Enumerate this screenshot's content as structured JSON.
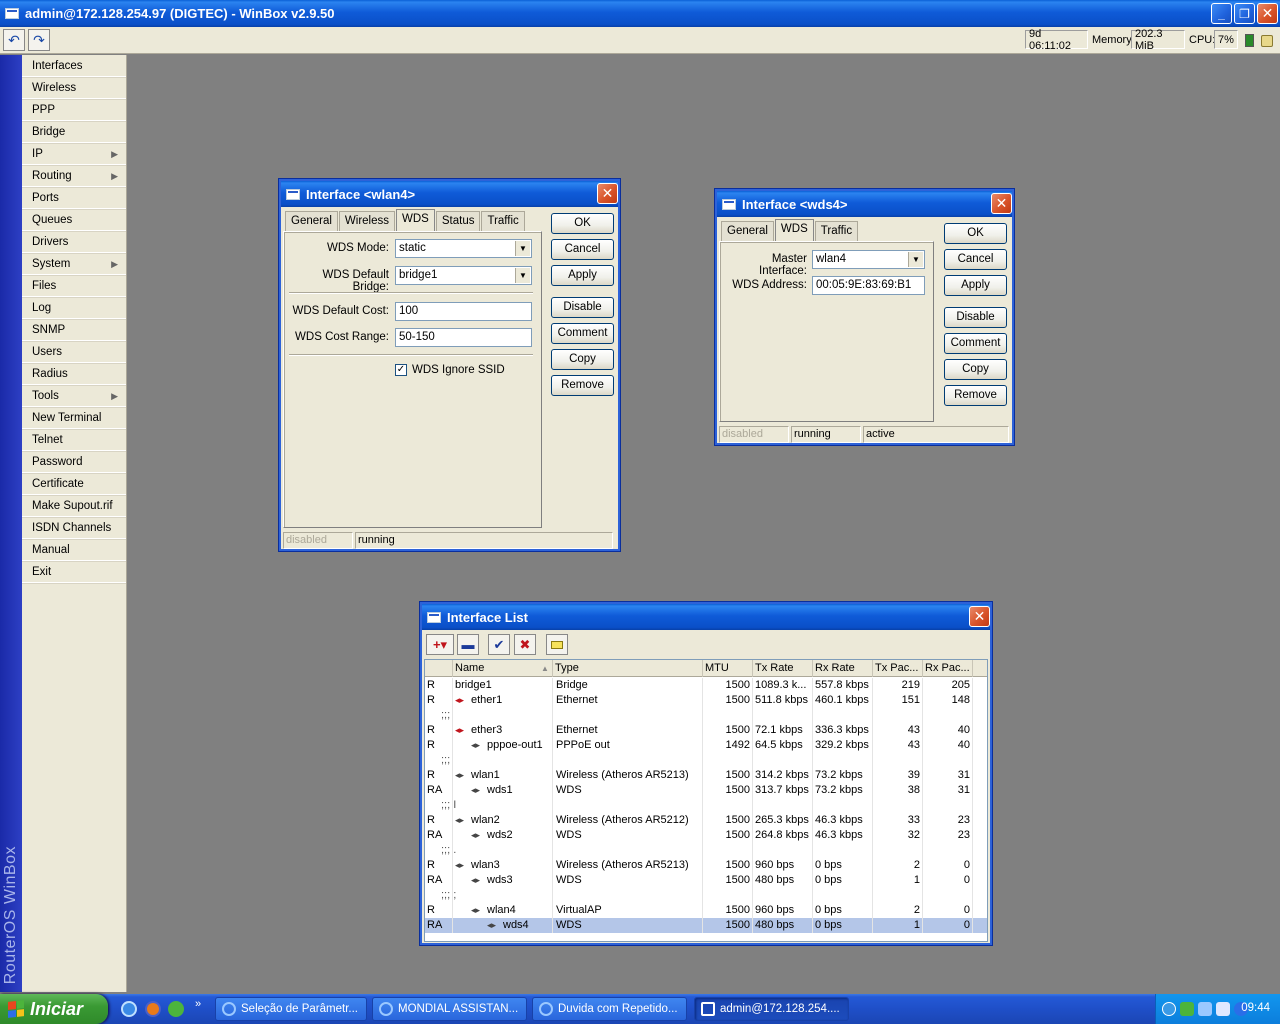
{
  "app": {
    "title": "admin@172.128.254.97 (DIGTEC) - WinBox v2.9.50"
  },
  "toolbar": {
    "uptime": "9d 06:11:02",
    "memory_label": "Memory:",
    "memory": "202.3 MiB",
    "cpu_label": "CPU:",
    "cpu": "7%"
  },
  "sidebar": {
    "brand": "RouterOS WinBox",
    "items": [
      {
        "label": "Interfaces"
      },
      {
        "label": "Wireless"
      },
      {
        "label": "PPP"
      },
      {
        "label": "Bridge"
      },
      {
        "label": "IP"
      },
      {
        "label": "Routing"
      },
      {
        "label": "Ports"
      },
      {
        "label": "Queues"
      },
      {
        "label": "Drivers"
      },
      {
        "label": "System"
      },
      {
        "label": "Files"
      },
      {
        "label": "Log"
      },
      {
        "label": "SNMP"
      },
      {
        "label": "Users"
      },
      {
        "label": "Radius"
      },
      {
        "label": "Tools"
      },
      {
        "label": "New Terminal"
      },
      {
        "label": "Telnet"
      },
      {
        "label": "Password"
      },
      {
        "label": "Certificate"
      },
      {
        "label": "Make Supout.rif"
      },
      {
        "label": "ISDN Channels"
      },
      {
        "label": "Manual"
      },
      {
        "label": "Exit"
      }
    ]
  },
  "wlan4": {
    "title": "Interface <wlan4>",
    "tabs": [
      "General",
      "Wireless",
      "WDS",
      "Status",
      "Traffic"
    ],
    "wds_mode_label": "WDS Mode:",
    "wds_mode": "static",
    "wds_bridge_label": "WDS Default Bridge:",
    "wds_bridge": "bridge1",
    "wds_cost_label": "WDS Default Cost:",
    "wds_cost": "100",
    "wds_range_label": "WDS Cost Range:",
    "wds_range": "50-150",
    "ignore_ssid_label": "WDS Ignore SSID",
    "ignore_ssid_mark": "✓",
    "buttons": {
      "ok": "OK",
      "cancel": "Cancel",
      "apply": "Apply",
      "disable": "Disable",
      "comment": "Comment",
      "copy": "Copy",
      "remove": "Remove"
    },
    "status": {
      "disabled": "disabled",
      "running": "running"
    }
  },
  "wds4": {
    "title": "Interface <wds4>",
    "tabs": [
      "General",
      "WDS",
      "Traffic"
    ],
    "master_label": "Master Interface:",
    "master": "wlan4",
    "address_label": "WDS Address:",
    "address": "00:05:9E:83:69:B1",
    "buttons": {
      "ok": "OK",
      "cancel": "Cancel",
      "apply": "Apply",
      "disable": "Disable",
      "comment": "Comment",
      "copy": "Copy",
      "remove": "Remove"
    },
    "status": {
      "disabled": "disabled",
      "running": "running",
      "active": "active"
    }
  },
  "iflist": {
    "title": "Interface List",
    "columns": [
      "Name",
      "Type",
      "MTU",
      "Tx Rate",
      "Rx Rate",
      "Tx Pac...",
      "Rx Pac..."
    ],
    "rows": [
      {
        "flag": "R",
        "indent": 0,
        "glyph": "",
        "name": "bridge1",
        "type": "Bridge",
        "mtu": "1500",
        "tx": "1089.3 k...",
        "rx": "557.8 kbps",
        "txp": "219",
        "rxp": "205"
      },
      {
        "flag": "R",
        "indent": 0,
        "glyph": "red",
        "name": "ether1",
        "type": "Ethernet",
        "mtu": "1500",
        "tx": "511.8 kbps",
        "rx": "460.1 kbps",
        "txp": "151",
        "rxp": "148"
      },
      {
        "comment": ";;;"
      },
      {
        "flag": "R",
        "indent": 0,
        "glyph": "red",
        "name": "ether3",
        "type": "Ethernet",
        "mtu": "1500",
        "tx": "72.1 kbps",
        "rx": "336.3 kbps",
        "txp": "43",
        "rxp": "40"
      },
      {
        "flag": "R",
        "indent": 1,
        "glyph": "grey",
        "name": "pppoe-out1",
        "type": "PPPoE out",
        "mtu": "1492",
        "tx": "64.5 kbps",
        "rx": "329.2 kbps",
        "txp": "43",
        "rxp": "40"
      },
      {
        "comment": ";;;"
      },
      {
        "flag": "R",
        "indent": 0,
        "glyph": "grey",
        "name": "wlan1",
        "type": "Wireless (Atheros AR5213)",
        "mtu": "1500",
        "tx": "314.2 kbps",
        "rx": "73.2 kbps",
        "txp": "39",
        "rxp": "31"
      },
      {
        "flag": "RA",
        "indent": 1,
        "glyph": "grey",
        "name": "wds1",
        "type": "WDS",
        "mtu": "1500",
        "tx": "313.7 kbps",
        "rx": "73.2 kbps",
        "txp": "38",
        "rxp": "31"
      },
      {
        "comment": ";;; I"
      },
      {
        "flag": "R",
        "indent": 0,
        "glyph": "grey",
        "name": "wlan2",
        "type": "Wireless (Atheros AR5212)",
        "mtu": "1500",
        "tx": "265.3 kbps",
        "rx": "46.3 kbps",
        "txp": "33",
        "rxp": "23"
      },
      {
        "flag": "RA",
        "indent": 1,
        "glyph": "grey",
        "name": "wds2",
        "type": "WDS",
        "mtu": "1500",
        "tx": "264.8 kbps",
        "rx": "46.3 kbps",
        "txp": "32",
        "rxp": "23"
      },
      {
        "comment": ";;; ."
      },
      {
        "flag": "R",
        "indent": 0,
        "glyph": "grey",
        "name": "wlan3",
        "type": "Wireless (Atheros AR5213)",
        "mtu": "1500",
        "tx": "960 bps",
        "rx": "0 bps",
        "txp": "2",
        "rxp": "0"
      },
      {
        "flag": "RA",
        "indent": 1,
        "glyph": "grey",
        "name": "wds3",
        "type": "WDS",
        "mtu": "1500",
        "tx": "480 bps",
        "rx": "0 bps",
        "txp": "1",
        "rxp": "0"
      },
      {
        "comment": ";;; ;"
      },
      {
        "flag": "R",
        "indent": 1,
        "glyph": "grey",
        "name": "wlan4",
        "type": "VirtualAP",
        "mtu": "1500",
        "tx": "960 bps",
        "rx": "0 bps",
        "txp": "2",
        "rxp": "0"
      },
      {
        "flag": "RA",
        "indent": 2,
        "glyph": "grey",
        "name": "wds4",
        "type": "WDS",
        "mtu": "1500",
        "tx": "480 bps",
        "rx": "0 bps",
        "txp": "1",
        "rxp": "0",
        "selected": true
      }
    ]
  },
  "taskbar": {
    "start": "Iniciar",
    "tasks": [
      "Seleção de Parâmetr...",
      "MONDIAL ASSISTAN...",
      "Duvida com Repetido...",
      "admin@172.128.254...."
    ],
    "clock": "09:44"
  },
  "colors": {
    "title_blue": "#0a4fc8",
    "close_red": "#d9542a",
    "dialog_bg": "#ece9d8",
    "desktop": "#808080",
    "selection": "#b4c6e8"
  }
}
